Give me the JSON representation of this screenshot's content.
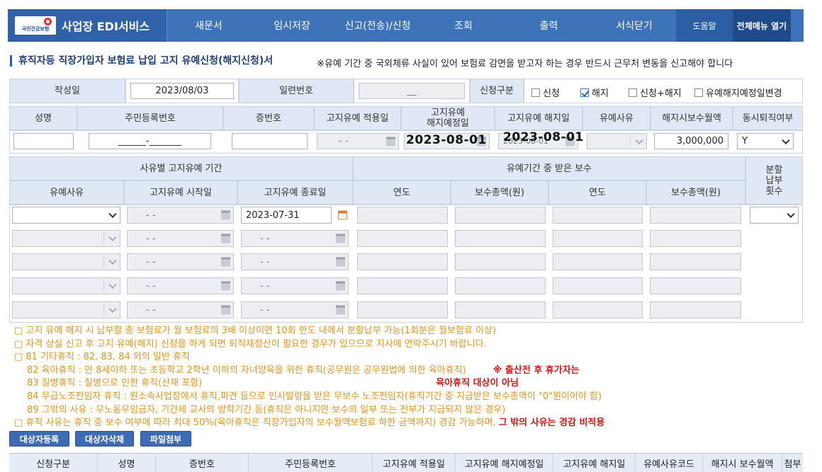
{
  "brand": {
    "logo_text": "국민건강보험",
    "name": "사업장 EDI서비스"
  },
  "nav": [
    "새문서",
    "임시저장",
    "신고(전송)/신청",
    "조회",
    "출력",
    "서식닫기"
  ],
  "nav_help": "도움말",
  "nav_all": "전체메뉴 열기",
  "page_title": "휴직자등 직장가입자 보험료 납입 고지 유예신청(해지신청)서",
  "notice": "※유예 기간 중 국외체류 사실이 있어 보험료 감면을 받고자 하는 경우 반드시 근무처 변동을 신고해야 합니다",
  "form_row1": {
    "written_date_label": "작성일",
    "written_date": "2023/08/03",
    "serial_label": "일련번호",
    "serial_value": "__",
    "apply_type_label": "신청구분",
    "options": [
      {
        "label": "신청",
        "checked": false
      },
      {
        "label": "해지",
        "checked": true
      },
      {
        "label": "신청+해지",
        "checked": false
      },
      {
        "label": "유예해지예정일변경",
        "checked": false
      }
    ]
  },
  "person_headers": {
    "name": "성명",
    "rrn": "주민등록번호",
    "cert": "증번호",
    "apply_date": "고지유예 적용일",
    "planned_line1": "고지유예",
    "planned_line2": "해지예정일",
    "cancel_date": "고지유예 해지일",
    "reason": "유예사유",
    "monthly_pay": "해지시보수월액",
    "retire": "동시퇴직여부"
  },
  "person_values": {
    "name": "",
    "rrn": "______-_______",
    "cert": "",
    "apply_date": "- -",
    "planned_date": "2023-08-01",
    "cancel_date_under": "2023-08-01",
    "cancel_date": "2023-08-01",
    "reason": "",
    "monthly_pay": "3,000,000",
    "retire": "Y"
  },
  "period_section": {
    "title": "사유별 고지유예 기간",
    "pay_title": "유예기간 중 받은 보수",
    "installment_line1": "분할",
    "installment_line2": "납부",
    "installment_line3": "횟수",
    "headers": [
      "유예사유",
      "고지유예 시작일",
      "고지유예 종료일",
      "연도",
      "보수총액(원)",
      "연도",
      "보수총액(원)"
    ],
    "rows": [
      {
        "start": "- -",
        "end": "2023-07-31"
      },
      {
        "start": "- -",
        "end": "- -"
      },
      {
        "start": "- -",
        "end": "- -"
      },
      {
        "start": "- -",
        "end": "- -"
      },
      {
        "start": "- -",
        "end": "- -"
      }
    ]
  },
  "notes": {
    "line1": "□ 고지 유예 해지 시 납부할 총 보험료가 월 보험료의 3배 이상이면 10회 한도 내에서 분할납부 가능(1회분은 월보험료 이상)",
    "line2": "□ 자격 상실 신고 후 고지 유예(해지) 신청을 하게 되면 퇴직재정산이 필요한 경우가 있으므로 지사에 연락주시기 바랍니다.",
    "line3": "□ 81 기타휴직 : 82, 83, 84 외의 일반 휴직",
    "line4": "82 육아휴직 : 만 8세이하 또는 초등학교 2학년 이하의 자녀양육을 위한 휴직(공무원은 공무원법에 의한 육아휴직)",
    "line4_red": "※ 출산전 후 휴가자는",
    "line5": "83 질병휴직 : 질병으로 인한 휴직(산재 포함)",
    "line5_red": "육아휴직 대상이 아님",
    "line6": "84 무급노조전임자 휴직 : 원소속사업장에서 휴직,파견 등으로 인사발령을 받은 무보수 노조전임자(휴직기간 중 지급받은 보수총액이 \"0\"원이어야 함)",
    "line7": "89 그밖의 사유 : 무노동무임금자, 기간제 교사의 방학기간 등(휴직은 아니지만 보수의 일부 또는 전부가 지급되지 않은 경우)",
    "line8": "□ 휴직 사유는 휴직 중 보수 여부에 따라 최대 50%(육아휴직은 직장가입자의 보수월액보험료 하한 금액까지) 경감 가능하며,",
    "line8_red": "그 밖의 사유는 경감 비적용"
  },
  "buttons": {
    "register": "대상자등록",
    "delete": "대상자삭제",
    "attach": "파일첨부"
  },
  "grid_headers": [
    "신청구분",
    "성명",
    "증번호",
    "주민등록번호",
    "고지유예 적용일",
    "고지유예 해지예정일",
    "고지유예 해지일",
    "유예사유코드",
    "해지시 보수월액",
    "첨부"
  ],
  "colors": {
    "nav": "#3f73b8",
    "label_bg": "#dfe8f4",
    "note": "#e0951d",
    "note_red": "#d41616"
  }
}
